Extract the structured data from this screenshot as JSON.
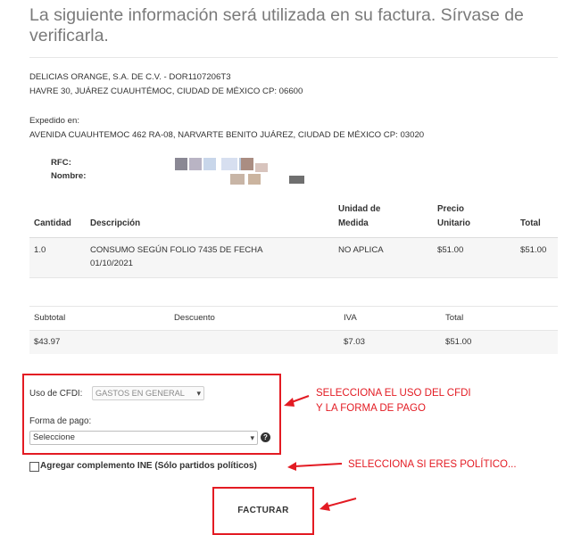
{
  "title": "La siguiente información será utilizada en su factura. Sírvase de verificarla.",
  "company": {
    "line1": "DELICIAS ORANGE, S.A. DE C.V. - DOR1107206T3",
    "line2": "HAVRE 30, JUÁREZ CUAUHTÉMOC, CIUDAD DE MÉXICO CP: 06600"
  },
  "issued": {
    "label": "Expedido en:",
    "address": "AVENIDA CUAUHTEMOC 462 RA-08, NARVARTE BENITO JUÁREZ, CIUDAD DE MÉXICO CP: 03020"
  },
  "customer": {
    "rfc_label": "RFC:",
    "name_label": "Nombre:"
  },
  "items_table": {
    "headers": {
      "cantidad": "Cantidad",
      "descripcion": "Descripción",
      "unidad_1": "Unidad de",
      "unidad_2": "Medida",
      "precio_1": "Precio",
      "precio_2": "Unitario",
      "total": "Total"
    },
    "rows": [
      {
        "cantidad": "1.0",
        "descripcion_1": "CONSUMO SEGÚN FOLIO 7435 DE FECHA",
        "descripcion_2": "01/10/2021",
        "unidad": "NO APLICA",
        "precio": "$51.00",
        "total": "$51.00"
      }
    ]
  },
  "totals_table": {
    "headers": {
      "subtotal": "Subtotal",
      "descuento": "Descuento",
      "iva": "IVA",
      "total": "Total"
    },
    "values": {
      "subtotal": "$43.97",
      "descuento": "",
      "iva": "$7.03",
      "total": "$51.00"
    }
  },
  "form": {
    "cfdi_label": "Uso de CFDI:",
    "cfdi_value": "GASTOS EN GENERAL",
    "pago_label": "Forma de pago:",
    "pago_value": "Seleccione",
    "help_glyph": "?",
    "ine_label": "Agregar complemento INE (Sólo partidos políticos)",
    "ine_checked": false,
    "submit_label": "FACTURAR"
  },
  "annotations": {
    "cfdi_1": "SELECCIONA EL USO DEL CFDI",
    "cfdi_2": "Y LA FORMA DE PAGO",
    "politico": "SELECCIONA SI ERES POLÍTICO..."
  },
  "colors": {
    "annotation_red": "#e31b23",
    "title_gray": "#7a7a7a",
    "row_bg": "#f6f6f6"
  }
}
